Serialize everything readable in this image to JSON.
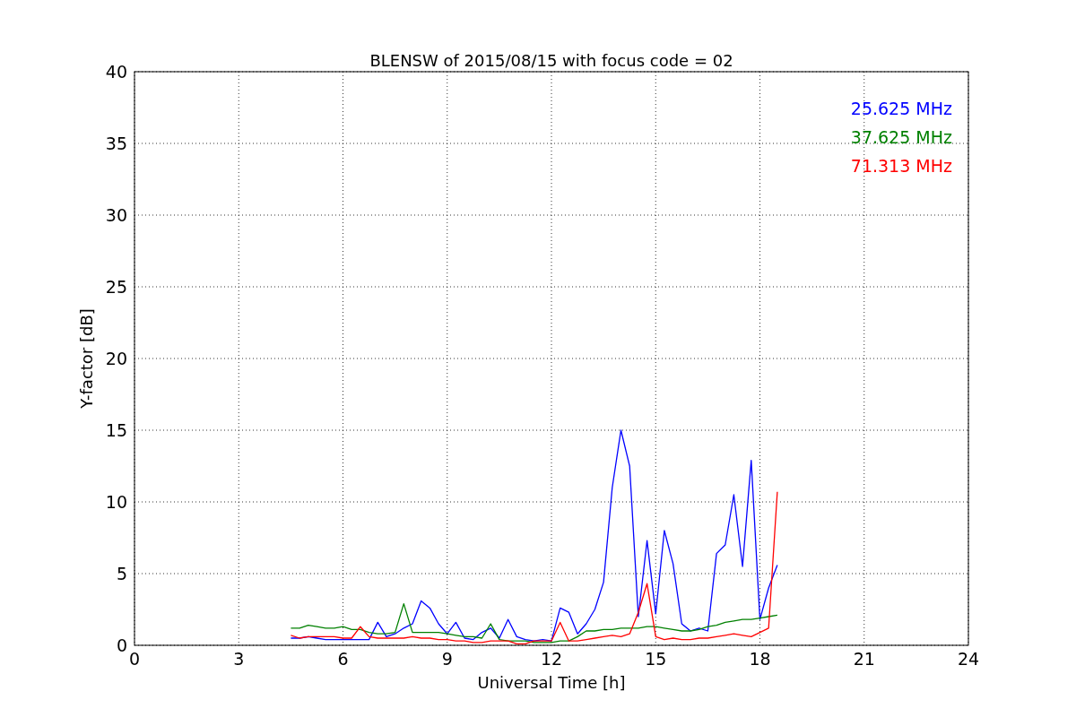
{
  "chart_data": {
    "type": "line",
    "title": "BLENSW of 2015/08/15 with focus code = 02",
    "xlabel": "Universal Time [h]",
    "ylabel": "Y-factor [dB]",
    "xlim": [
      0,
      24
    ],
    "ylim": [
      0,
      40
    ],
    "xticks": [
      0,
      3,
      6,
      9,
      12,
      15,
      18,
      21,
      24
    ],
    "yticks": [
      0,
      5,
      10,
      15,
      20,
      25,
      30,
      35,
      40
    ],
    "grid": true,
    "x": [
      4.5,
      4.75,
      5,
      5.25,
      5.5,
      5.75,
      6,
      6.25,
      6.5,
      6.75,
      7,
      7.25,
      7.5,
      7.75,
      8,
      8.25,
      8.5,
      8.75,
      9,
      9.25,
      9.5,
      9.75,
      10,
      10.25,
      10.5,
      10.75,
      11,
      11.25,
      11.5,
      11.75,
      12,
      12.25,
      12.5,
      12.75,
      13,
      13.25,
      13.5,
      13.75,
      14,
      14.25,
      14.5,
      14.75,
      15,
      15.25,
      15.5,
      15.75,
      16,
      16.25,
      16.5,
      16.75,
      17,
      17.25,
      17.5,
      17.75,
      18,
      18.25,
      18.5
    ],
    "series": [
      {
        "name": "25.625 MHz",
        "color": "#0000ff",
        "values": [
          0.5,
          0.5,
          0.6,
          0.5,
          0.4,
          0.4,
          0.4,
          0.4,
          0.4,
          0.4,
          1.6,
          0.6,
          0.8,
          1.2,
          1.5,
          3.1,
          2.6,
          1.5,
          0.8,
          1.6,
          0.5,
          0.4,
          0.9,
          1.2,
          0.5,
          1.8,
          0.6,
          0.4,
          0.3,
          0.4,
          0.3,
          2.6,
          2.3,
          0.8,
          1.5,
          2.5,
          4.4,
          11.0,
          15.0,
          12.5,
          2.0,
          7.3,
          2.2,
          8.0,
          5.7,
          1.5,
          1.0,
          1.2,
          1.0,
          6.4,
          7.0,
          10.5,
          5.5,
          12.9,
          1.8,
          4.0,
          5.6
        ]
      },
      {
        "name": "37.625 MHz",
        "color": "#008000",
        "values": [
          1.2,
          1.2,
          1.4,
          1.3,
          1.2,
          1.2,
          1.3,
          1.1,
          1.1,
          0.9,
          0.8,
          0.8,
          0.9,
          2.9,
          0.9,
          0.9,
          0.9,
          0.9,
          0.8,
          0.7,
          0.6,
          0.6,
          0.5,
          1.5,
          0.4,
          0.3,
          0.3,
          0.3,
          0.2,
          0.2,
          0.2,
          0.3,
          0.3,
          0.6,
          1.0,
          1.0,
          1.1,
          1.1,
          1.2,
          1.2,
          1.2,
          1.3,
          1.3,
          1.2,
          1.1,
          1.0,
          1.0,
          1.1,
          1.3,
          1.4,
          1.6,
          1.7,
          1.8,
          1.8,
          1.9,
          2.0,
          2.1
        ]
      },
      {
        "name": "71.313 MHz",
        "color": "#ff0000",
        "values": [
          0.7,
          0.5,
          0.6,
          0.6,
          0.6,
          0.6,
          0.5,
          0.5,
          1.3,
          0.6,
          0.5,
          0.5,
          0.5,
          0.5,
          0.6,
          0.5,
          0.5,
          0.4,
          0.4,
          0.3,
          0.3,
          0.2,
          0.2,
          0.3,
          0.3,
          0.3,
          0.1,
          0.1,
          0.3,
          0.3,
          0.3,
          1.6,
          0.3,
          0.3,
          0.4,
          0.5,
          0.6,
          0.7,
          0.6,
          0.8,
          2.3,
          4.3,
          0.6,
          0.4,
          0.5,
          0.4,
          0.4,
          0.5,
          0.5,
          0.6,
          0.7,
          0.8,
          0.7,
          0.6,
          0.9,
          1.2,
          10.7
        ]
      }
    ]
  }
}
